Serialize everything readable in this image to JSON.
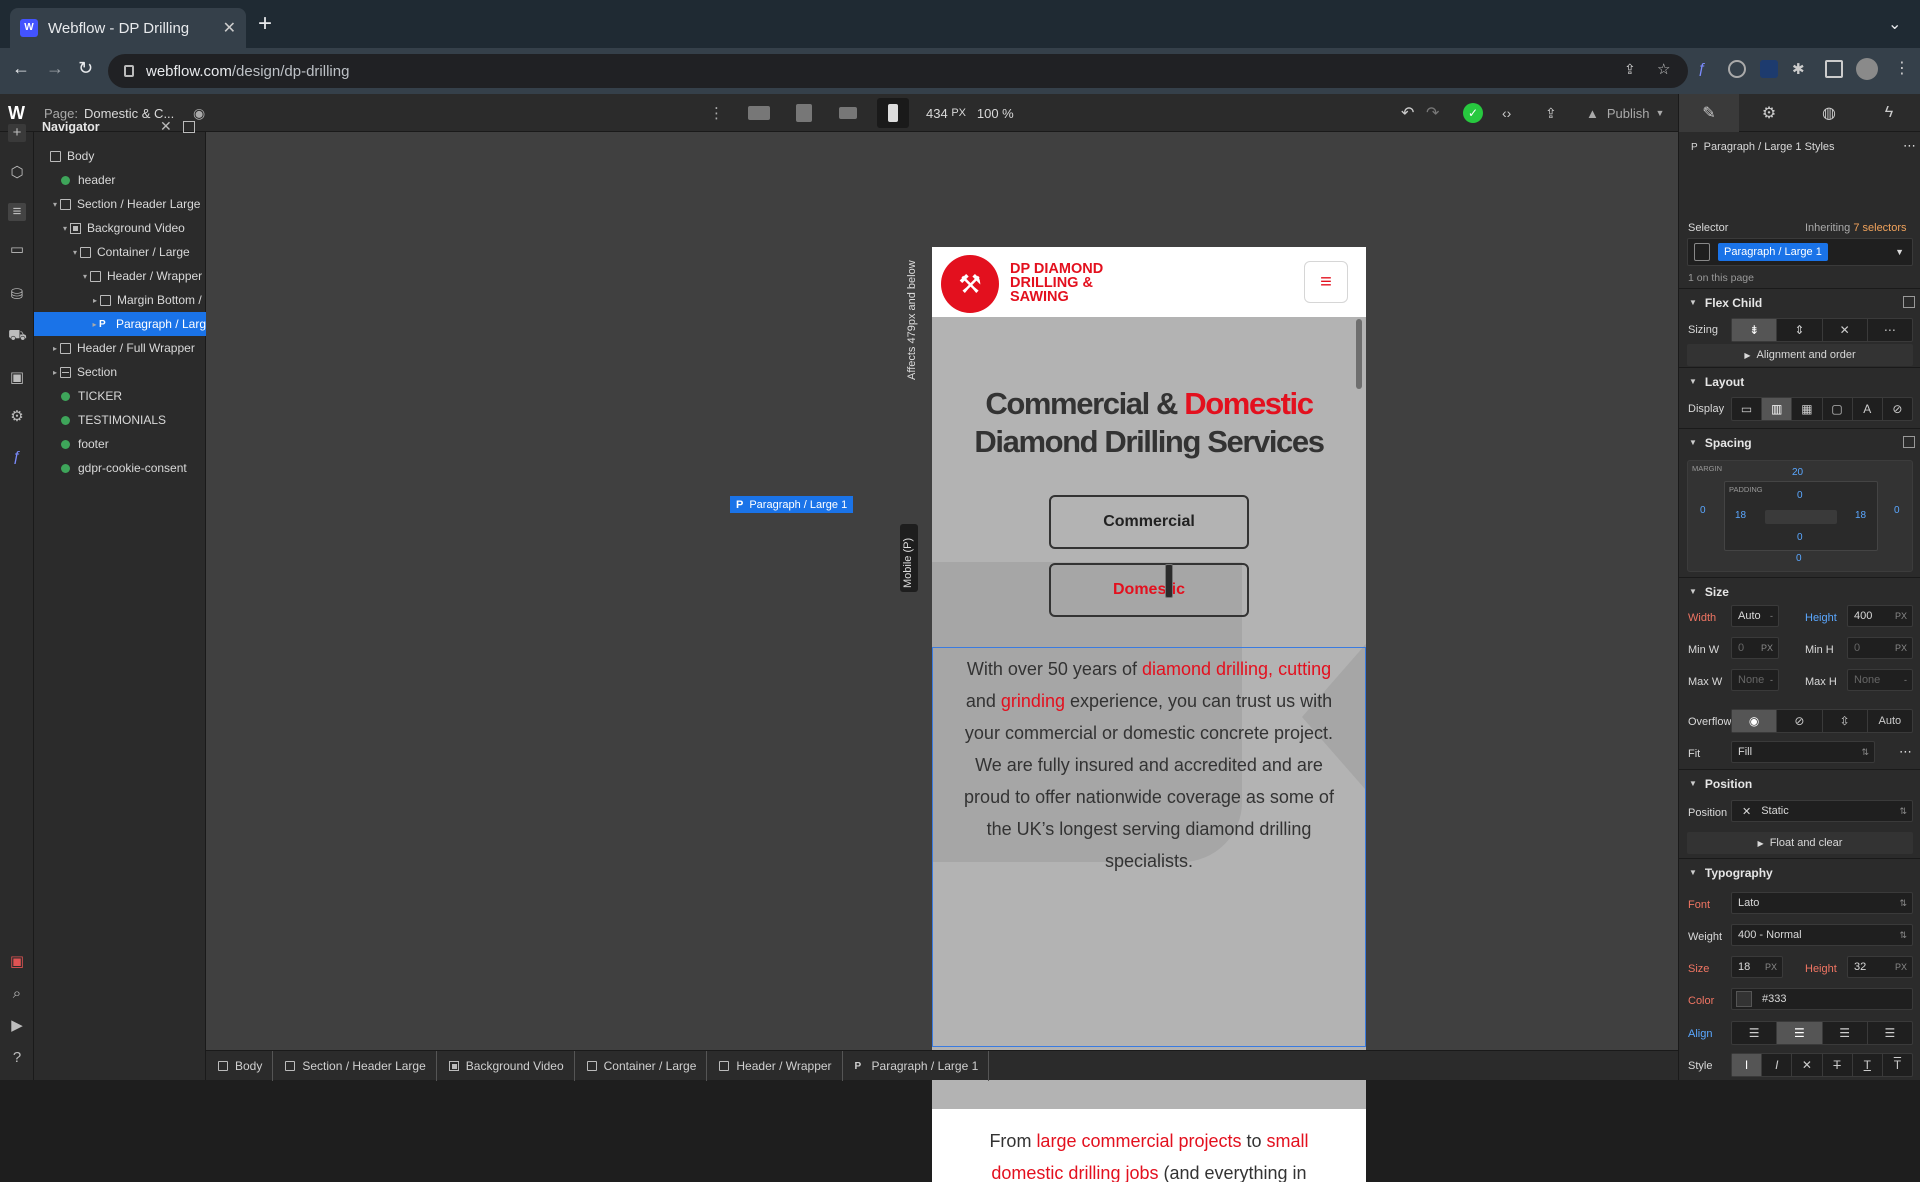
{
  "browser": {
    "tab_title": "Webflow - DP Drilling",
    "url_host": "webflow.com",
    "url_path": "/design/dp-drilling"
  },
  "designer": {
    "page_label": "Page:",
    "page_name": "Domestic & C...",
    "canvas_width": "434",
    "canvas_unit": "PX",
    "zoom": "100 %",
    "publish_label": "Publish"
  },
  "navigator": {
    "title": "Navigator",
    "items": [
      {
        "label": "Body",
        "icon": "box-icon",
        "depth": 0,
        "caret": ""
      },
      {
        "label": "header",
        "icon": "symbol-icon",
        "depth": 1,
        "caret": ""
      },
      {
        "label": "Section / Header Large",
        "icon": "box-icon",
        "depth": 1,
        "caret": "▾"
      },
      {
        "label": "Background Video",
        "icon": "video-icon",
        "depth": 2,
        "caret": "▾"
      },
      {
        "label": "Container / Large",
        "icon": "box-icon",
        "depth": 3,
        "caret": "▾"
      },
      {
        "label": "Header / Wrapper",
        "icon": "box-icon",
        "depth": 4,
        "caret": "▾"
      },
      {
        "label": "Margin Bottom /",
        "icon": "box-icon",
        "depth": 5,
        "caret": "▸"
      },
      {
        "label": "Paragraph / Larg",
        "icon": "paragraph-icon",
        "depth": 5,
        "caret": "▸",
        "selected": true
      },
      {
        "label": "Header / Full Wrapper",
        "icon": "box-icon",
        "depth": 1,
        "caret": "▸"
      },
      {
        "label": "Section",
        "icon": "section-icon",
        "depth": 1,
        "caret": "▸"
      },
      {
        "label": "TICKER",
        "icon": "symbol-icon",
        "depth": 1,
        "caret": ""
      },
      {
        "label": "TESTIMONIALS",
        "icon": "symbol-icon",
        "depth": 1,
        "caret": ""
      },
      {
        "label": "footer",
        "icon": "symbol-icon",
        "depth": 1,
        "caret": ""
      },
      {
        "label": "gdpr-cookie-consent",
        "icon": "symbol-icon",
        "depth": 1,
        "caret": ""
      }
    ]
  },
  "canvas": {
    "breakpoint_label": "Mobile (P)",
    "affects_label": "Affects 479px and below",
    "selected_tag": "P",
    "selected_label": "Paragraph / Large 1",
    "site": {
      "logo_line1": "DP DIAMOND",
      "logo_line2": "DRILLING &",
      "logo_line3": "SAWING",
      "heading_part1": "Commercial & ",
      "heading_accent": "Domestic",
      "heading_part2": " Diamond Drilling Services",
      "button_commercial": "Commercial",
      "button_domestic": "Domestic",
      "para1_a": "With over 50 years of ",
      "para1_link1": "diamond drilling",
      "para1_comma": ", ",
      "para1_link2": "cutting",
      "para1_b": " and ",
      "para1_link3": "grinding",
      "para1_c": " experience, you can trust us with your commercial or domestic concrete project. We are fully insured and accredited and are proud to offer nationwide coverage as some of the UK’s longest serving diamond drilling specialists.",
      "para2_a": "From ",
      "para2_link1": "large commercial projects",
      "para2_b": " to ",
      "para2_link2": "small domestic drilling jobs",
      "para2_c": " (and everything in"
    }
  },
  "breadcrumbs": [
    "Body",
    "Section / Header Large",
    "Background Video",
    "Container / Large",
    "Header / Wrapper",
    "Paragraph / Large 1"
  ],
  "style_panel": {
    "heading_tag": "P",
    "heading": "Paragraph / Large 1 Styles",
    "selector_label": "Selector",
    "inheriting_prefix": "Inheriting",
    "inheriting_count": "7 selectors",
    "selector_value": "Paragraph / Large 1",
    "on_page": "1 on this page",
    "flex_child": "Flex Child",
    "sizing_label": "Sizing",
    "alignment_order": "Alignment and order",
    "layout": "Layout",
    "display_label": "Display",
    "spacing": "Spacing",
    "margin_label": "MARGIN",
    "padding_label": "PADDING",
    "margin_top": "20",
    "margin_left": "0",
    "margin_right": "0",
    "margin_bottom": "0",
    "padding_top": "0",
    "padding_left": "18",
    "padding_right": "18",
    "padding_bottom": "0",
    "size": "Size",
    "width_label": "Width",
    "width_value": "Auto",
    "height_label": "Height",
    "height_value": "400",
    "height_unit": "PX",
    "minw_label": "Min W",
    "minw_value": "0",
    "minw_unit": "PX",
    "minh_label": "Min H",
    "minh_value": "0",
    "minh_unit": "PX",
    "maxw_label": "Max W",
    "maxw_value": "None",
    "maxh_label": "Max H",
    "maxh_value": "None",
    "overflow_label": "Overflow",
    "overflow_auto": "Auto",
    "fit_label": "Fit",
    "fit_value": "Fill",
    "position_section": "Position",
    "position_label": "Position",
    "position_value": "Static",
    "float_clear": "Float and clear",
    "typography": "Typography",
    "font_label": "Font",
    "font_value": "Lato",
    "weight_label": "Weight",
    "weight_value": "400 - Normal",
    "tsize_label": "Size",
    "tsize_value": "18",
    "tsize_unit": "PX",
    "lheight_label": "Height",
    "lheight_value": "32",
    "lheight_unit": "PX",
    "color_label": "Color",
    "color_value": "#333",
    "align_label": "Align",
    "style_label": "Style"
  },
  "colors": {
    "accent": "#1a73e8",
    "brand_red": "#e3101e",
    "webflow_blue": "#4353ff",
    "symbol_green": "#3ea55a"
  }
}
